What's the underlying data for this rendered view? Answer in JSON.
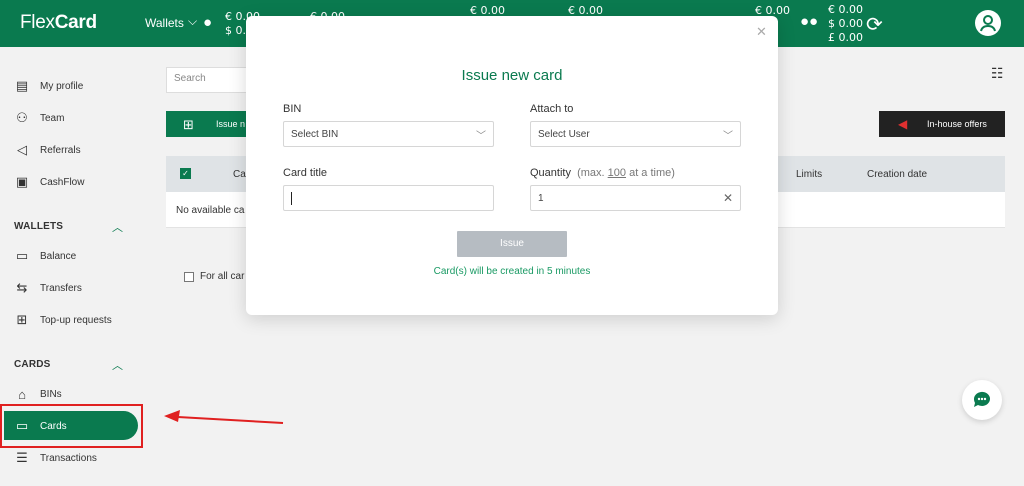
{
  "app": {
    "logo_prefix": "Flex",
    "logo_suffix": "Card"
  },
  "topbar": {
    "wallets_label": "Wallets",
    "balances": [
      {
        "line1": "€ 0.00",
        "line2": "$ 0.00"
      },
      {
        "line1": "€ 0.00"
      },
      {
        "line1": "€ 0.00"
      },
      {
        "line1": "€ 0.00"
      },
      {
        "line1": "€ 0.00"
      },
      {
        "line1": "€ 0.00"
      },
      {
        "line1": "€ 0.00",
        "line2": "$ 0.00",
        "line3": "£ 0.00"
      }
    ]
  },
  "sidebar": {
    "items_top": [
      {
        "label": "My profile",
        "icon": "chart-icon"
      },
      {
        "label": "Team",
        "icon": "team-icon"
      },
      {
        "label": "Referrals",
        "icon": "megaphone-icon"
      },
      {
        "label": "CashFlow",
        "icon": "cashflow-icon"
      }
    ],
    "wallets_heading": "WALLETS",
    "wallet_items": [
      {
        "label": "Balance",
        "icon": "wallet-icon"
      },
      {
        "label": "Transfers",
        "icon": "transfer-icon"
      },
      {
        "label": "Top-up requests",
        "icon": "topup-icon"
      }
    ],
    "cards_heading": "CARDS",
    "card_items": [
      {
        "label": "BINs",
        "icon": "bank-icon"
      },
      {
        "label": "Cards",
        "icon": "card-icon"
      },
      {
        "label": "Transactions",
        "icon": "list-icon"
      }
    ]
  },
  "main": {
    "search_placeholder": "Search",
    "issue_button": "Issue n",
    "inhouse_button": "In-house offers",
    "table": {
      "headers": [
        "Ca",
        "Limits",
        "Creation date"
      ],
      "empty": "No available ca"
    },
    "for_all_label": "For all car"
  },
  "modal": {
    "title": "Issue new card",
    "bin_label": "BIN",
    "bin_placeholder": "Select BIN",
    "attach_label": "Attach to",
    "attach_placeholder": "Select User",
    "card_title_label": "Card title",
    "card_title_value": "",
    "quantity_label": "Quantity",
    "quantity_hint_pre": "(max.",
    "quantity_hint_max": "100",
    "quantity_hint_post": "at a time)",
    "quantity_value": "1",
    "issue_button": "Issue",
    "note": "Card(s) will be created in 5 minutes"
  },
  "colors": {
    "brand": "#0a7a4f",
    "highlight": "#e02020"
  }
}
